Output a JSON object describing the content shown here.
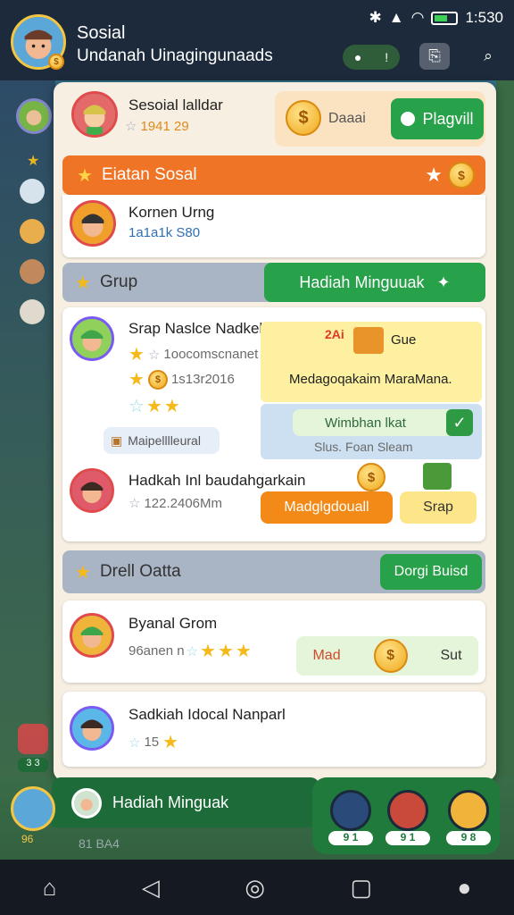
{
  "status_bar": {
    "time": "1:530"
  },
  "header": {
    "title": "Sosial",
    "subtitle": "Undanah Uinagingunaads",
    "pill_left": "●",
    "pill_right": "!"
  },
  "profile": {
    "name": "Sesoial lalldar",
    "score": "1941 29",
    "coin_label": "Daaai",
    "play_button": "Plagvill"
  },
  "social_banner": {
    "label": "Eiatan Sosal"
  },
  "friend": {
    "name": "Kornen Urng",
    "points": "1a1a1k S80"
  },
  "group_banner": {
    "label": "Grup",
    "reward_button": "Hadiah Minguuak"
  },
  "group_card": {
    "name": "Srap Naslce Nadkeloumah",
    "stars_text": "1oocomscnanet",
    "coin_text": "1s13r2016",
    "tag": "Maipelllleural",
    "promo_title": "Gue",
    "promo_badge": "2Ai",
    "promo_text": "Medagoqakaim MaraMana.",
    "claim_label": "Wimbhan lkat",
    "claim_sub": "Slus. Foan Sleam"
  },
  "reward_row": {
    "name": "Hadkah Inl baudahgarkain",
    "points": "122.2406Mm",
    "orange_button": "Madglgdouall",
    "yellow_button": "Srap"
  },
  "daily_banner": {
    "label": "Drell Oatta",
    "button": "Dorgi Buisd"
  },
  "row1": {
    "name": "Byanal Grom",
    "sub": "96anen n",
    "action_left": "Mad",
    "action_right": "Sut"
  },
  "row2": {
    "name": "Sadkiah Idocal Nanparl",
    "sub": "15"
  },
  "footer": {
    "label": "Hadiah Minguak",
    "left_count": "96",
    "left_sub": "81 BA4",
    "badges": [
      "9 1",
      "9 1",
      "9 8"
    ]
  },
  "left_rail": {
    "bottom_badge": "3 3"
  },
  "colors": {
    "green": "#27a14a",
    "orange": "#f38a17",
    "accent_blue": "#5aa7d8"
  },
  "icons": [
    "wifi-icon",
    "signal-icon",
    "battery-icon",
    "gift-icon",
    "search-icon",
    "coin-icon",
    "star-icon",
    "check-icon",
    "home-icon",
    "back-icon",
    "circle-icon",
    "square-icon",
    "person-icon"
  ]
}
